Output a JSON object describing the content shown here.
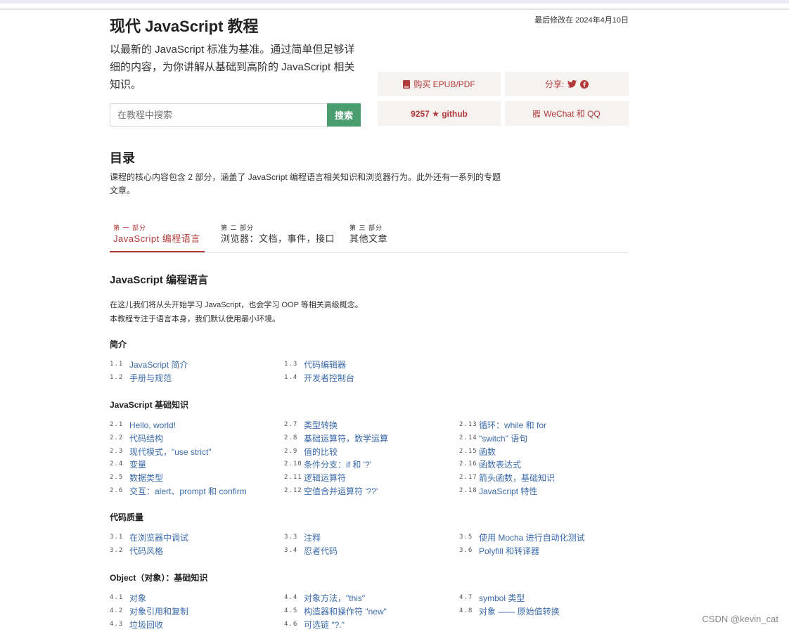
{
  "page": {
    "title": "现代 JavaScript 教程",
    "last_modified": "最后修改在 2024年4月10日",
    "intro": "以最新的 JavaScript 标准为基准。通过简单但足够详细的内容，为你讲解从基础到高阶的 JavaScript 相关知识。"
  },
  "search": {
    "placeholder": "在教程中搜索",
    "button_label": "搜索"
  },
  "actions": {
    "buy": "购买 EPUB/PDF",
    "share": "分享:",
    "github": "9257 ★  github",
    "wechat": "WeChat 和 QQ"
  },
  "toc": {
    "title": "目录",
    "description": "课程的核心内容包含 2 部分，涵盖了 JavaScript 编程语言相关知识和浏览器行为。此外还有一系列的专题文章。"
  },
  "tabs": [
    {
      "part": "第 一 部分",
      "label": "JavaScript 编程语言",
      "active": true
    },
    {
      "part": "第 二 部分",
      "label": "浏览器：文档，事件，接口",
      "active": false
    },
    {
      "part": "第 三 部分",
      "label": "其他文章",
      "active": false
    }
  ],
  "section": {
    "title": "JavaScript 编程语言",
    "desc_line1": "在这儿我们将从头开始学习 JavaScript，也会学习 OOP 等相关高级概念。",
    "desc_line2": "本教程专注于语言本身，我们默认使用最小环境。"
  },
  "chapters": [
    {
      "title": "简介",
      "columns": [
        [
          {
            "num": "1.1",
            "title": "JavaScript 简介"
          },
          {
            "num": "1.2",
            "title": "手册与规范"
          }
        ],
        [
          {
            "num": "1.3",
            "title": "代码编辑器"
          },
          {
            "num": "1.4",
            "title": "开发者控制台"
          }
        ],
        []
      ]
    },
    {
      "title": "JavaScript 基础知识",
      "columns": [
        [
          {
            "num": "2.1",
            "title": "Hello, world!"
          },
          {
            "num": "2.2",
            "title": "代码结构"
          },
          {
            "num": "2.3",
            "title": "现代模式，\"use strict\""
          },
          {
            "num": "2.4",
            "title": "变量"
          },
          {
            "num": "2.5",
            "title": "数据类型"
          },
          {
            "num": "2.6",
            "title": "交互：alert、prompt 和 confirm"
          }
        ],
        [
          {
            "num": "2.7",
            "title": "类型转换"
          },
          {
            "num": "2.8",
            "title": "基础运算符，数学运算"
          },
          {
            "num": "2.9",
            "title": "值的比较"
          },
          {
            "num": "2.10",
            "title": "条件分支：if 和 '?'"
          },
          {
            "num": "2.11",
            "title": "逻辑运算符"
          },
          {
            "num": "2.12",
            "title": "空值合并运算符 '??'"
          }
        ],
        [
          {
            "num": "2.13",
            "title": "循环：while 和 for"
          },
          {
            "num": "2.14",
            "title": "\"switch\" 语句"
          },
          {
            "num": "2.15",
            "title": "函数"
          },
          {
            "num": "2.16",
            "title": "函数表达式"
          },
          {
            "num": "2.17",
            "title": "箭头函数，基础知识"
          },
          {
            "num": "2.18",
            "title": "JavaScript 特性"
          }
        ]
      ]
    },
    {
      "title": "代码质量",
      "columns": [
        [
          {
            "num": "3.1",
            "title": "在浏览器中调试"
          },
          {
            "num": "3.2",
            "title": "代码风格"
          }
        ],
        [
          {
            "num": "3.3",
            "title": "注释"
          },
          {
            "num": "3.4",
            "title": "忍者代码"
          }
        ],
        [
          {
            "num": "3.5",
            "title": "使用 Mocha 进行自动化测试"
          },
          {
            "num": "3.6",
            "title": "Polyfill 和转译器"
          }
        ]
      ]
    },
    {
      "title": "Object（对象）：基础知识",
      "columns": [
        [
          {
            "num": "4.1",
            "title": "对象"
          },
          {
            "num": "4.2",
            "title": "对象引用和复制"
          },
          {
            "num": "4.3",
            "title": "垃圾回收"
          }
        ],
        [
          {
            "num": "4.4",
            "title": "对象方法，\"this\""
          },
          {
            "num": "4.5",
            "title": "构造器和操作符 \"new\""
          },
          {
            "num": "4.6",
            "title": "可选链 \"?.\""
          }
        ],
        [
          {
            "num": "4.7",
            "title": "symbol 类型"
          },
          {
            "num": "4.8",
            "title": "对象 —— 原始值转换"
          }
        ]
      ]
    }
  ],
  "watermark": "CSDN @kevin_cat",
  "colors": {
    "accent": "#b33a3a",
    "link": "#3b6bab",
    "search_button": "#4a9d6e",
    "action_bg": "#f5f2f0"
  }
}
